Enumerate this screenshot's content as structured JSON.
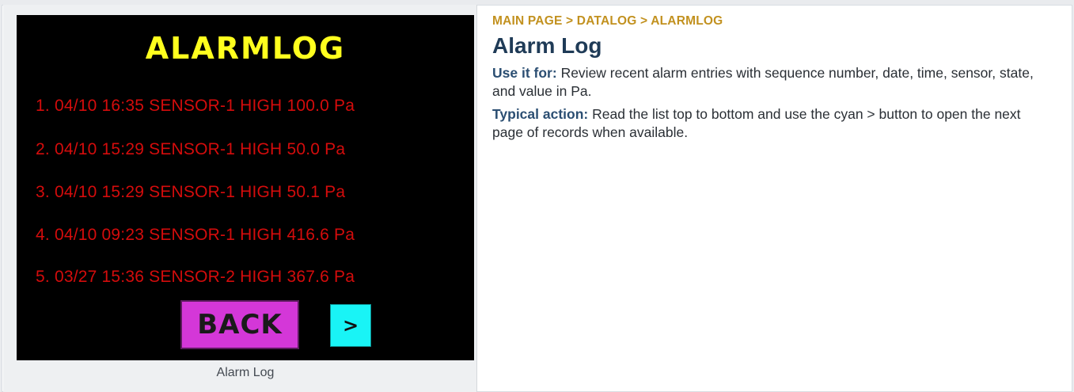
{
  "hmi": {
    "title": "ALARMLOG",
    "alarms": [
      "1. 04/10 16:35 SENSOR-1 HIGH 100.0 Pa",
      "2. 04/10 15:29 SENSOR-1 HIGH 50.0 Pa",
      "3. 04/10 15:29 SENSOR-1 HIGH 50.1 Pa",
      "4. 04/10 09:23 SENSOR-1 HIGH 416.6 Pa",
      "5. 03/27 15:36 SENSOR-2 HIGH 367.6 Pa"
    ],
    "back_label": "BACK",
    "next_label": ">"
  },
  "caption": "Alarm Log",
  "breadcrumb": {
    "items": [
      "MAIN PAGE",
      "DATALOG",
      "ALARMLOG"
    ],
    "separator": ">"
  },
  "page_title": "Alarm Log",
  "use_it_for": {
    "label": "Use it for:",
    "text": "Review recent alarm entries with sequence number, date, time, sensor, state, and value in Pa."
  },
  "typical_action": {
    "label": "Typical action:",
    "text": "Read the list top to bottom and use the cyan > button to open the next page of records when available."
  },
  "colors": {
    "title_yellow": "#ffff1e",
    "alarm_red": "#d40c0c",
    "back_magenta": "#d437d8",
    "next_cyan": "#19f4f6",
    "breadcrumb_gold": "#c2911f",
    "heading_navy": "#1f3b57"
  }
}
